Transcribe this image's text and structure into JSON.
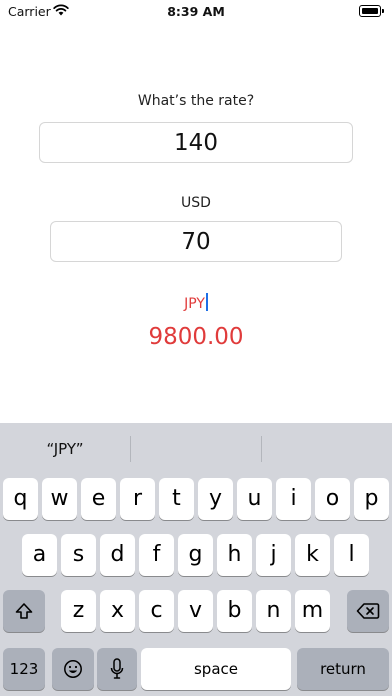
{
  "status_bar": {
    "carrier": "Carrier",
    "time": "8:39 AM"
  },
  "form": {
    "rate_label": "What’s the rate?",
    "rate_value": "140",
    "from_currency_label": "USD",
    "amount_value": "70",
    "to_currency_code": "JPY",
    "result_value": "9800.00"
  },
  "keyboard": {
    "suggestions": [
      "“JPY”",
      "",
      ""
    ],
    "row1": [
      "q",
      "w",
      "e",
      "r",
      "t",
      "y",
      "u",
      "i",
      "o",
      "p"
    ],
    "row2": [
      "a",
      "s",
      "d",
      "f",
      "g",
      "h",
      "j",
      "k",
      "l"
    ],
    "row3": [
      "z",
      "x",
      "c",
      "v",
      "b",
      "n",
      "m"
    ],
    "numbers_key": "123",
    "space_key": "space",
    "return_key": "return"
  },
  "colors": {
    "accent_red": "#e03b3b",
    "cursor_blue": "#1f6fe5",
    "keyboard_bg": "#d3d5db"
  },
  "icons": [
    "wifi-icon",
    "battery-icon",
    "shift-icon",
    "backspace-icon",
    "emoji-icon",
    "microphone-icon"
  ]
}
